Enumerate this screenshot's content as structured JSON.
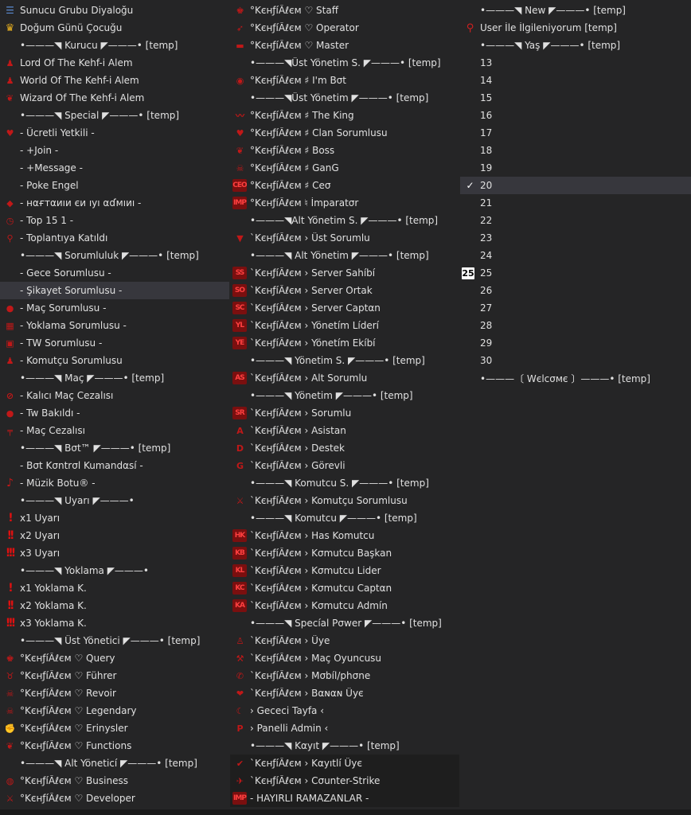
{
  "columns": [
    {
      "items": [
        {
          "icon": "list-icon",
          "text": "Sunucu Grubu Diyaloğu"
        },
        {
          "icon": "crown-icon",
          "text": "Doğum Günü Çocuğu"
        },
        {
          "icon": "",
          "text": "•———◥ Kurucu ◤———• [temp]"
        },
        {
          "icon": "person-icon",
          "text": "Lord Of The Kehf-i Alem"
        },
        {
          "icon": "person-icon",
          "text": "World Of The Kehf-i Alem"
        },
        {
          "icon": "wings-icon",
          "text": "Wizard Of The Kehf-i Alem"
        },
        {
          "icon": "",
          "text": "•———◥ Special ◤———• [temp]"
        },
        {
          "icon": "heart-wings-icon",
          "text": "- Ücretli Yetkili -"
        },
        {
          "icon": "",
          "text": "- +Join -"
        },
        {
          "icon": "",
          "text": "- +Message -"
        },
        {
          "icon": "",
          "text": "- Poke Engel"
        },
        {
          "icon": "diamond-icon",
          "text": "- нαғтαиıи єи ıуı αɗмıиı -"
        },
        {
          "icon": "clock-icon",
          "text": "- Top 15 1 -"
        },
        {
          "icon": "pin-icon",
          "text": "- Toplantıya Katıldı"
        },
        {
          "icon": "",
          "text": "•———◥ Sorumluluk ◤———• [temp]"
        },
        {
          "icon": "",
          "text": "- Gece Sorumlusu -"
        },
        {
          "icon": "",
          "text": "- Şikayet Sorumlusu -",
          "highlight": true
        },
        {
          "icon": "ball-icon",
          "text": "- Maç Sorumlusu -"
        },
        {
          "icon": "calendar-icon",
          "text": "- Yoklama Sorumlusu -"
        },
        {
          "icon": "box-icon",
          "text": "- TW Sorumlusu -"
        },
        {
          "icon": "person-icon",
          "text": "- Komutçu Sorumlusu"
        },
        {
          "icon": "",
          "text": "•———◥ Maç ◤———• [temp]"
        },
        {
          "icon": "ban-icon",
          "text": "- Kalıcı Maç Cezalısı"
        },
        {
          "icon": "blob-icon",
          "text": "- Tw Bakıldı -"
        },
        {
          "icon": "gun-icon",
          "text": "- Maç Cezalısı"
        },
        {
          "icon": "",
          "text": "•———◥ Bσt™ ◤———• [temp]"
        },
        {
          "icon": "",
          "text": "- Bσt Kσntrσl Kumandαsí -"
        },
        {
          "icon": "music-note-icon",
          "text": "- Müzik Botu® -"
        },
        {
          "icon": "",
          "text": "•———◥ Uyarı ◤———•"
        },
        {
          "icon": "exclamation-1-icon",
          "text": "x1 Uyarı"
        },
        {
          "icon": "exclamation-2-icon",
          "text": "x2 Uyarı"
        },
        {
          "icon": "exclamation-3-icon",
          "text": "x3 Uyarı"
        },
        {
          "icon": "",
          "text": "•———◥ Yoklama ◤———•"
        },
        {
          "icon": "exclamation-1-icon",
          "text": "x1 Yoklama K."
        },
        {
          "icon": "exclamation-2-icon",
          "text": "x2 Yoklama K."
        },
        {
          "icon": "exclamation-3-icon",
          "text": "x3 Yoklama K."
        },
        {
          "icon": "",
          "text": "•———◥ Üst Yönetici ◤———• [temp]"
        },
        {
          "icon": "crown-badge-icon",
          "text": "°KєнƒíÂℓєм ♡ Query"
        },
        {
          "icon": "bull-icon",
          "text": "°KєнƒíÂℓєм ♡ Führer"
        },
        {
          "icon": "skull-icon",
          "text": "°KєнƒíÂℓєм ♡ Revoir"
        },
        {
          "icon": "skull-icon",
          "text": "°KєнƒíÂℓєм ♡ Legendary"
        },
        {
          "icon": "fist-icon",
          "text": "°KєнƒíÂℓєм ♡ Erinysler"
        },
        {
          "icon": "wings-icon",
          "text": "°KєнƒíÂℓєм ♡ Functions"
        },
        {
          "icon": "",
          "text": "•———◥ Alt Yöneticí ◤———• [temp]"
        },
        {
          "icon": "globe-icon",
          "text": "°KєнƒíÂℓєм ♡ Business"
        },
        {
          "icon": "swords-icon",
          "text": "°KєнƒíÂℓєм ♡ Developer"
        }
      ]
    },
    {
      "items": [
        {
          "icon": "crown-badge-icon",
          "text": "°KєнƒíÂℓєм ♡ Staff"
        },
        {
          "icon": "bolt-icon",
          "text": "°KєнƒíÂℓєм ♡ Operator"
        },
        {
          "icon": "bar-icon",
          "text": "°KєнƒíÂℓєм ♡ Master"
        },
        {
          "icon": "",
          "text": "•———◥Üst Yönetim S. ◤———• [temp]"
        },
        {
          "icon": "ring-icon",
          "text": "°KєнƒíÂℓєм ♯ I'm Bσt"
        },
        {
          "icon": "",
          "text": "•———◥Üst Yönetim ◤———• [temp]"
        },
        {
          "icon": "mustache-icon",
          "text": "°KєнƒíÂℓєм ♯ The King"
        },
        {
          "icon": "heart-wings-icon",
          "text": "°KєнƒíÂℓєм ♯ Clan Sorumlusu"
        },
        {
          "icon": "wings-icon",
          "text": "°KєнƒíÂℓєм ♯ Boss"
        },
        {
          "icon": "skull-icon",
          "text": "°KєнƒíÂℓєм ♯ GanG"
        },
        {
          "icon": "ceo-icon",
          "text": "°KєнƒíÂℓєм ♯ Ceσ"
        },
        {
          "icon": "imp-icon",
          "text": "°KєнƒíÂℓєм ♮ İmparatσr"
        },
        {
          "icon": "",
          "text": "•———◥Alt Yönetim S. ◤———• [temp]"
        },
        {
          "icon": "gem-icon",
          "text": "`KєнƒíÂℓєм › Üst Sorumlu"
        },
        {
          "icon": "",
          "text": "•———◥ Alt Yönetim ◤———• [temp]"
        },
        {
          "icon": "ss-icon",
          "text": "`KєнƒíÂℓєм › Server Sahíbí"
        },
        {
          "icon": "so-icon",
          "text": "`KєнƒíÂℓєм › Server Ortak"
        },
        {
          "icon": "sc-icon",
          "text": "`KєнƒíÂℓєм › Server Captαn"
        },
        {
          "icon": "yl-icon",
          "text": "`KєнƒíÂℓєм › Yönetím Líderí"
        },
        {
          "icon": "ye-icon",
          "text": "`KєнƒíÂℓєм › Yönetím Ekíbí"
        },
        {
          "icon": "",
          "text": "•———◥ Yönetim S. ◤———• [temp]"
        },
        {
          "icon": "as-icon",
          "text": "`KєнƒíÂℓєм › Alt Sorumlu"
        },
        {
          "icon": "",
          "text": "•———◥ Yönetim ◤———• [temp]"
        },
        {
          "icon": "sr-icon",
          "text": "`KєнƒíÂℓєм › Sorumlu"
        },
        {
          "icon": "a-icon",
          "text": "`KєнƒíÂℓєм › Asistan"
        },
        {
          "icon": "d-icon",
          "text": "`KєнƒíÂℓєм › Destek"
        },
        {
          "icon": "g-icon",
          "text": "`KєнƒíÂℓєм › Görevli"
        },
        {
          "icon": "",
          "text": "•———◥ Komutcu S. ◤———• [temp]"
        },
        {
          "icon": "swords-icon",
          "text": "`KєнƒíÂℓєм › Komutçu Sorumlusu"
        },
        {
          "icon": "",
          "text": "•———◥ Komutcu ◤———• [temp]"
        },
        {
          "icon": "hk-icon",
          "text": "`KєнƒíÂℓєм › Has Komutcu"
        },
        {
          "icon": "kb-icon",
          "text": "`KєнƒíÂℓєм › Kσmutcu Başkan"
        },
        {
          "icon": "kl-icon",
          "text": "`KєнƒíÂℓєм › Kσmutcu Lider"
        },
        {
          "icon": "kc-icon",
          "text": "`KєнƒíÂℓєм › Kσmutcu Captαn"
        },
        {
          "icon": "ka-icon",
          "text": "`KєнƒíÂℓєм › Kσmutcu Admín"
        },
        {
          "icon": "",
          "text": "•———◥ Specíal Pσwer ◤———• [temp]"
        },
        {
          "icon": "user-icon",
          "text": "`KєнƒíÂℓєм › Üye"
        },
        {
          "icon": "knife-icon",
          "text": "`KєнƒíÂℓєм › Maç Oyuncusu"
        },
        {
          "icon": "phone-icon",
          "text": "`KєнƒíÂℓєм › Mσbíl/phσne"
        },
        {
          "icon": "heart-icon",
          "text": "`KєнƒíÂℓєм › Bαɴαɴ Üує"
        },
        {
          "icon": "moon-icon",
          "text": "› Gececi Tayfa ‹"
        },
        {
          "icon": "p-icon",
          "text": "› Panelli Admin ‹"
        },
        {
          "icon": "",
          "text": "•———◥ Kαyıt ◤———• [temp]"
        },
        {
          "icon": "check-mark-icon",
          "text": "`KєнƒíÂℓєм › Kαyıtlí Üyє",
          "selected": true
        },
        {
          "icon": "runner-icon",
          "text": "`KєнƒíÂℓєм › Cσunter-Strike",
          "selected": true
        },
        {
          "icon": "imp-icon",
          "text": "- HAYIRLI RAMAZANLAR -",
          "selected": true
        }
      ]
    },
    {
      "items": [
        {
          "icon": "",
          "text": "•———◥ New ◤———• [temp]"
        },
        {
          "icon": "magnifier-icon",
          "text": "User İle İlgileniyorum [temp]"
        },
        {
          "icon": "",
          "text": "•———◥ Yaş ◤———• [temp]"
        },
        {
          "icon": "",
          "text": "13"
        },
        {
          "icon": "",
          "text": "14"
        },
        {
          "icon": "",
          "text": "15"
        },
        {
          "icon": "",
          "text": "16"
        },
        {
          "icon": "",
          "text": "17"
        },
        {
          "icon": "",
          "text": "18"
        },
        {
          "icon": "",
          "text": "19"
        },
        {
          "icon": "check-icon",
          "text": "20",
          "highlight": true
        },
        {
          "icon": "",
          "text": "21"
        },
        {
          "icon": "",
          "text": "22"
        },
        {
          "icon": "",
          "text": "23"
        },
        {
          "icon": "",
          "text": "24"
        },
        {
          "icon": "number-25-icon",
          "text": "25"
        },
        {
          "icon": "",
          "text": "26"
        },
        {
          "icon": "",
          "text": "27"
        },
        {
          "icon": "",
          "text": "28"
        },
        {
          "icon": "",
          "text": "29"
        },
        {
          "icon": "",
          "text": "30"
        },
        {
          "icon": "",
          "text": "•———〔 Wєlcσмє 〕———• [temp]"
        }
      ]
    }
  ],
  "icon_glyphs": {
    "list-icon": "☰",
    "crown-icon": "♛",
    "person-icon": "♟",
    "wings-icon": "❦",
    "heart-wings-icon": "♥",
    "diamond-icon": "◆",
    "clock-icon": "◷",
    "pin-icon": "⚲",
    "ball-icon": "●",
    "calendar-icon": "▦",
    "box-icon": "▣",
    "ban-icon": "⊘",
    "blob-icon": "●",
    "gun-icon": "╤",
    "music-note-icon": "♪",
    "exclamation-1-icon": "!",
    "exclamation-2-icon": "!!",
    "exclamation-3-icon": "!!!",
    "crown-badge-icon": "♚",
    "bull-icon": "♉",
    "skull-icon": "☠",
    "fist-icon": "✊",
    "globe-icon": "◍",
    "swords-icon": "⚔",
    "bolt-icon": "➶",
    "bar-icon": "▬",
    "ring-icon": "◉",
    "mustache-icon": "〰",
    "ceo-icon": "CEO",
    "imp-icon": "IMP",
    "gem-icon": "▼",
    "ss-icon": "SS",
    "so-icon": "SO",
    "sc-icon": "SC",
    "yl-icon": "YL",
    "ye-icon": "YE",
    "as-icon": "AS",
    "sr-icon": "SR",
    "a-icon": "A",
    "d-icon": "D",
    "g-icon": "G",
    "hk-icon": "HK",
    "kb-icon": "KB",
    "kl-icon": "KL",
    "kc-icon": "KC",
    "ka-icon": "KA",
    "user-icon": "♙",
    "knife-icon": "⚒",
    "phone-icon": "✆",
    "heart-icon": "❤",
    "moon-icon": "☾",
    "p-icon": "P",
    "check-mark-icon": "✔",
    "runner-icon": "✈",
    "magnifier-icon": "⚲",
    "check-icon": "✓",
    "number-25-icon": "25"
  }
}
